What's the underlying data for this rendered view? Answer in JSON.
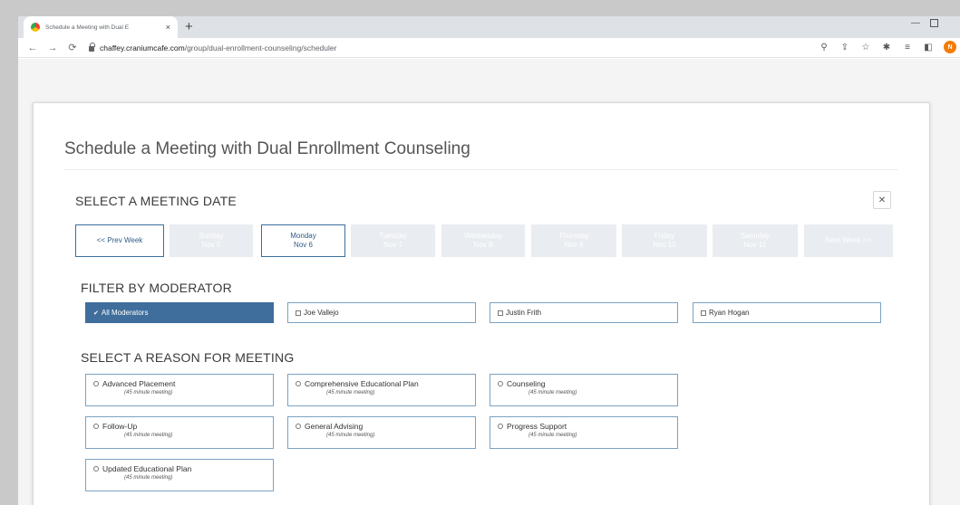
{
  "browser": {
    "tab_title": "Schedule a Meeting with Dual E",
    "tab_close": "×",
    "new_tab": "+",
    "url_host": "chaffey.craniumcafe.com",
    "url_path": "/group/dual-enrollment-counseling/scheduler",
    "profile_initial": "N",
    "nav_icons": [
      "back-arrow-icon",
      "forward-arrow-icon",
      "reload-icon"
    ],
    "toolbar_icons": [
      "zoom-icon",
      "share-icon",
      "star-icon",
      "extensions-icon",
      "reading-list-icon",
      "side-panel-icon"
    ],
    "profile_color": "#f57c00"
  },
  "page": {
    "title": "Schedule a Meeting with Dual Enrollment Counseling",
    "close_icon": "close-icon"
  },
  "date_section": {
    "heading": "SELECT A MEETING DATE",
    "prev_label": "<< Prev Week",
    "next_label": "Next Week >>",
    "days": [
      {
        "day": "Sunday",
        "date": "Nov 5",
        "state": "disabled"
      },
      {
        "day": "Monday",
        "date": "Nov 6",
        "state": "active"
      },
      {
        "day": "Tuesday",
        "date": "Nov 7",
        "state": "disabled"
      },
      {
        "day": "Wednesday",
        "date": "Nov 8",
        "state": "disabled"
      },
      {
        "day": "Thursday",
        "date": "Nov 9",
        "state": "disabled"
      },
      {
        "day": "Friday",
        "date": "Nov 10",
        "state": "disabled"
      },
      {
        "day": "Saturday",
        "date": "Nov 11",
        "state": "disabled"
      }
    ]
  },
  "moderator_section": {
    "heading": "FILTER BY MODERATOR",
    "options": [
      {
        "label": "All Moderators",
        "selected": true
      },
      {
        "label": "Joe Vallejo",
        "selected": false
      },
      {
        "label": "Justin Frith",
        "selected": false
      },
      {
        "label": "Ryan Hogan",
        "selected": false
      }
    ]
  },
  "reason_section": {
    "heading": "SELECT A REASON FOR MEETING",
    "options": [
      {
        "label": "Advanced Placement",
        "duration": "(45 minute meeting)"
      },
      {
        "label": "Comprehensive Educational Plan",
        "duration": "(45 minute meeting)"
      },
      {
        "label": "Counseling",
        "duration": "(45 minute meeting)"
      },
      {
        "label": "Follow-Up",
        "duration": "(45 minute meeting)"
      },
      {
        "label": "General Advising",
        "duration": "(45 minute meeting)"
      },
      {
        "label": "Progress Support",
        "duration": "(45 minute meeting)"
      },
      {
        "label": "Updated Educational Plan",
        "duration": "(45 minute meeting)"
      }
    ]
  },
  "colors": {
    "accent": "#3f6e9c",
    "border": "#7aa2c4",
    "disabled_bg": "#e9ecf0"
  }
}
